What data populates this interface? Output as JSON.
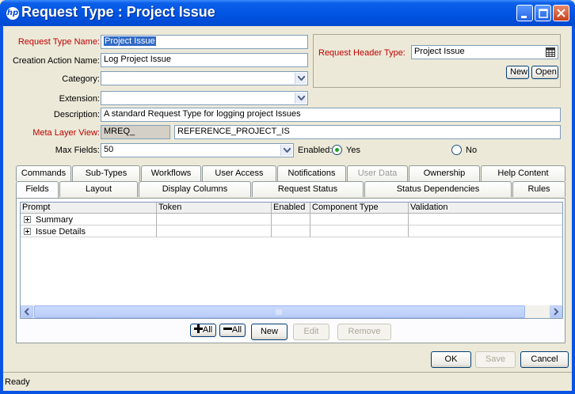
{
  "window": {
    "title": "Request Type : Project Issue",
    "app_icon": "hp-logo-icon",
    "controls": [
      "minimize-icon",
      "maximize-icon",
      "close-icon"
    ]
  },
  "form": {
    "request_type_name": {
      "label": "Request Type Name:",
      "value": "Project Issue"
    },
    "creation_action_name": {
      "label": "Creation Action Name:",
      "value": "Log Project Issue"
    },
    "category": {
      "label": "Category:",
      "value": ""
    },
    "extension": {
      "label": "Extension:",
      "value": ""
    },
    "description": {
      "label": "Description:",
      "value": "A standard Request Type for logging project Issues"
    },
    "meta_layer_view": {
      "label": "Meta Layer View:",
      "prefix": "MREQ_",
      "value": "REFERENCE_PROJECT_IS"
    },
    "max_fields": {
      "label": "Max Fields:",
      "value": "50"
    },
    "enabled": {
      "label": "Enabled:",
      "yes": "Yes",
      "no": "No",
      "selected": "Yes"
    }
  },
  "header_type": {
    "label": "Request Header Type:",
    "value": "Project Issue",
    "new_label": "New",
    "open_label": "Open"
  },
  "tabs_back": [
    "Commands",
    "Sub-Types",
    "Workflows",
    "User Access",
    "Notifications",
    "User Data",
    "Ownership",
    "Help Content"
  ],
  "tabs_front": [
    "Fields",
    "Layout",
    "Display Columns",
    "Request Status",
    "Status Dependencies",
    "Rules"
  ],
  "active_tab": "Fields",
  "fields_table": {
    "columns": [
      "Prompt",
      "Token",
      "Enabled",
      "Component Type",
      "Validation"
    ],
    "rows": [
      {
        "prompt": "Summary"
      },
      {
        "prompt": "Issue Details"
      }
    ]
  },
  "table_buttons": {
    "expand_all": "All",
    "collapse_all": "All",
    "new": "New",
    "edit": "Edit",
    "remove": "Remove"
  },
  "dialog_buttons": {
    "ok": "OK",
    "save": "Save",
    "cancel": "Cancel"
  },
  "status_bar": {
    "text": "Ready"
  },
  "colors": {
    "title_bar": "#0054e3",
    "required_label": "#c00000",
    "selection": "#316ac5"
  }
}
